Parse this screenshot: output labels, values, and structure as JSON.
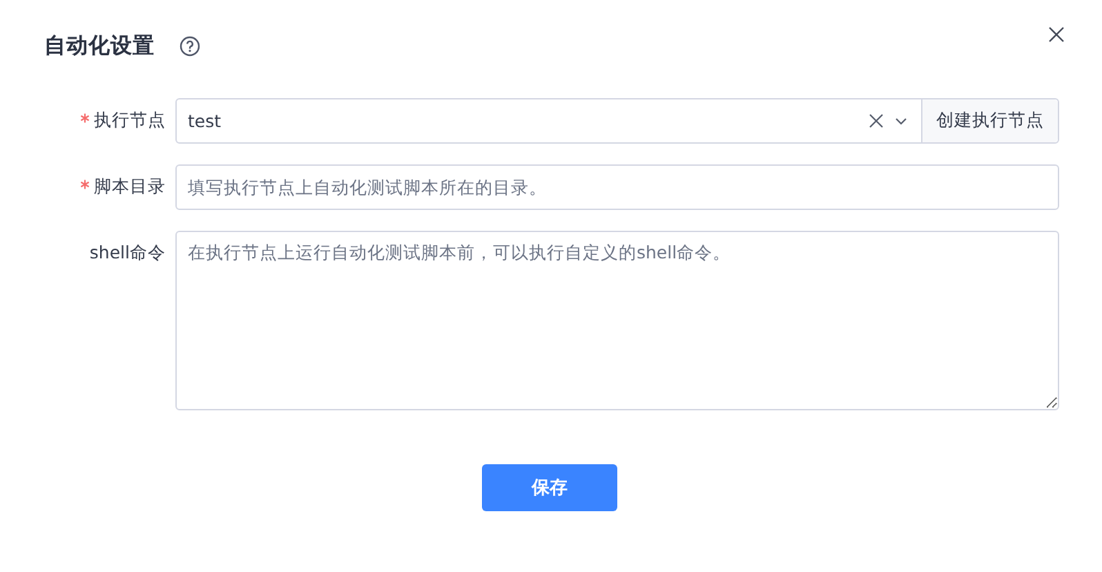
{
  "dialog": {
    "title": "自动化设置"
  },
  "fields": [
    {
      "kind": "select",
      "label": "执行节点",
      "required": true,
      "value": "test",
      "addon": "创建执行节点"
    },
    {
      "kind": "input",
      "label": "脚本目录",
      "required": true,
      "placeholder": "填写执行节点上自动化测试脚本所在的目录。"
    },
    {
      "kind": "textarea",
      "label": "shell命令",
      "required": false,
      "placeholder": "在执行节点上运行自动化测试脚本前，可以执行自定义的shell命令。"
    }
  ],
  "buttons": [
    {
      "label": "保存"
    }
  ]
}
